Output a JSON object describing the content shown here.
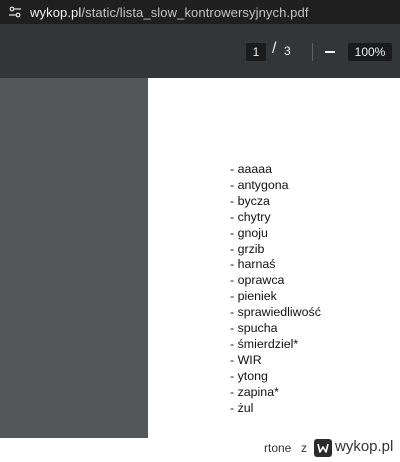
{
  "browser": {
    "url_domain": "wykop.pl",
    "url_path": "/static/lista_slow_kontrowersyjnych.pdf",
    "site_info_icon": "tune-icon"
  },
  "pdf_toolbar": {
    "current_page": "1",
    "page_separator": "/",
    "total_pages": "3",
    "zoom_level": "100%"
  },
  "document": {
    "words": [
      "- aaaaa",
      "- antygona",
      "- bycza",
      "- chytry",
      "- gnoju",
      "- grzib",
      "- harnaś",
      "- oprawca",
      "- pieniek",
      "- sprawiedliwość",
      "- spucha",
      "- śmierdziel*",
      "- WIR",
      "- ytong",
      "- zapina*",
      "- żul"
    ]
  },
  "footer": {
    "author": "rtone",
    "separator": "z",
    "site": "wykop.pl",
    "logo_icon": "wykop-logo-icon"
  }
}
